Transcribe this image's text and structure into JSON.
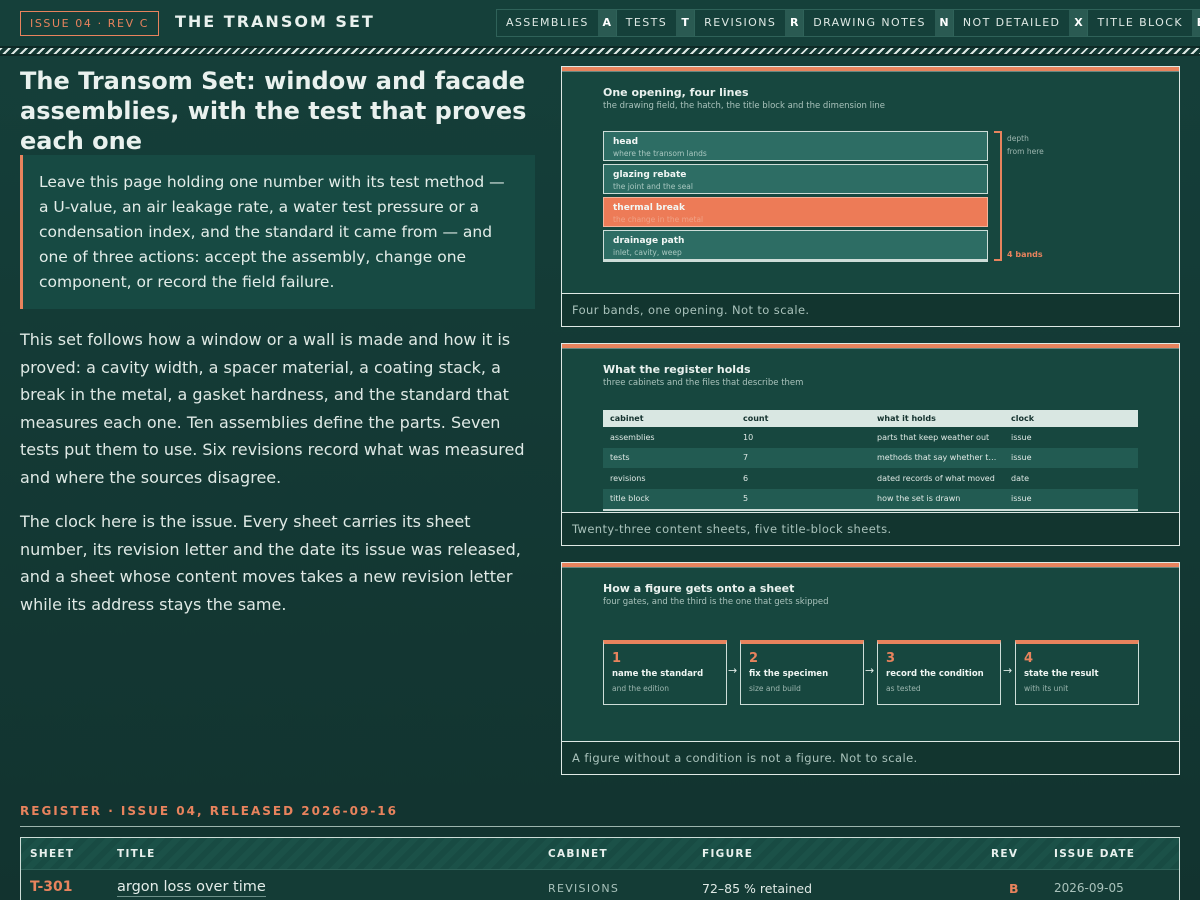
{
  "header": {
    "issue_badge": "ISSUE 04 · REV C",
    "site_title": "THE TRANSOM SET",
    "nav": [
      {
        "label": "ASSEMBLIES",
        "key": "A"
      },
      {
        "label": "TESTS",
        "key": "T"
      },
      {
        "label": "REVISIONS",
        "key": "R"
      },
      {
        "label": "DRAWING NOTES",
        "key": "N"
      },
      {
        "label": "NOT DETAILED",
        "key": "X"
      },
      {
        "label": "TITLE BLOCK",
        "key": "B"
      }
    ]
  },
  "intro": {
    "title": "The Transom Set: window and facade assemblies, with the test that proves each one",
    "goal": "Leave this page holding one number with its test method — a U-value, an air leakage rate, a water test pressure or a condensation index, and the standard it came from — and one of three actions: accept the assembly, change one component, or record the field failure.",
    "para1": "This set follows how a window or a wall is made and how it is proved: a cavity width, a spacer material, a coating stack, a break in the metal, a gasket hardness, and the standard that measures each one. Ten assemblies define the parts. Seven tests put them to use. Six revisions record what was measured and where the sources disagree.",
    "para2": "The clock here is the issue. Every sheet carries its sheet number, its revision letter and the date its issue was released, and a sheet whose content moves takes a new revision letter while its address stays the same."
  },
  "fig1": {
    "title": "One opening, four lines",
    "subtitle": "the drawing field, the hatch, the title block and the dimension line",
    "bands": [
      {
        "name": "head",
        "note": "where the transom lands"
      },
      {
        "name": "glazing rebate",
        "note": "the joint and the seal"
      },
      {
        "name": "thermal break",
        "note": "the change in the metal"
      },
      {
        "name": "drainage path",
        "note": "inlet, cavity, weep"
      }
    ],
    "dim_note_1": "depth",
    "dim_note_2": "from here",
    "dim_count": "4 bands",
    "caption": "Four bands, one opening. Not to scale."
  },
  "fig2": {
    "title": "What the register holds",
    "subtitle": "three cabinets and the files that describe them",
    "columns": [
      "cabinet",
      "count",
      "what it holds",
      "clock"
    ],
    "rows": [
      [
        "assemblies",
        "10",
        "parts that keep weather out",
        "issue"
      ],
      [
        "tests",
        "7",
        "methods that say whether t…",
        "issue"
      ],
      [
        "revisions",
        "6",
        "dated records of what moved",
        "date"
      ],
      [
        "title block",
        "5",
        "how the set is drawn",
        "issue"
      ]
    ],
    "caption": "Twenty-three content sheets, five title-block sheets."
  },
  "fig3": {
    "title": "How a figure gets onto a sheet",
    "subtitle": "four gates, and the third is the one that gets skipped",
    "gates": [
      {
        "num": "1",
        "label": "name the standard",
        "note": "and the edition"
      },
      {
        "num": "2",
        "label": "fix the specimen",
        "note": "size and build"
      },
      {
        "num": "3",
        "label": "record the condition",
        "note": "as tested"
      },
      {
        "num": "4",
        "label": "state the result",
        "note": "with its unit"
      }
    ],
    "caption": "A figure without a condition is not a figure. Not to scale."
  },
  "register": {
    "heading": "REGISTER · ISSUE 04, RELEASED 2026-09-16",
    "columns": [
      "SHEET",
      "TITLE",
      "CABINET",
      "FIGURE",
      "REV",
      "ISSUE DATE"
    ],
    "rows": [
      {
        "sheet": "T-301",
        "title": "argon loss over time",
        "cabinet": "REVISIONS",
        "figure": "72–85 % retained",
        "rev": "B",
        "date": "2026-09-05"
      }
    ]
  },
  "colors": {
    "accent": "#e8835d",
    "background": "#153f3a",
    "panel": "#17473f"
  }
}
